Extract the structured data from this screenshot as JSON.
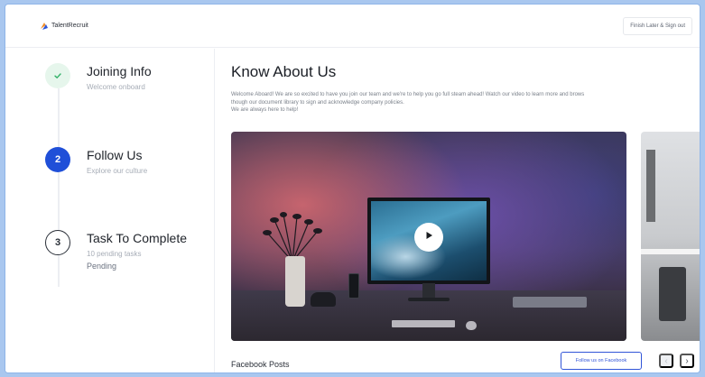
{
  "app": {
    "name": "TalentRecruit"
  },
  "header": {
    "signout_label": "Finish Later & Sign out"
  },
  "steps": [
    {
      "index": "✓",
      "title": "Joining Info",
      "subtitle": "Welcome onboard",
      "state": "done"
    },
    {
      "index": "2",
      "title": "Follow Us",
      "subtitle": "Explore our culture",
      "state": "active"
    },
    {
      "index": "3",
      "title": "Task To Complete",
      "subtitle": "10 pending tasks",
      "status": "Pending",
      "state": "pending"
    }
  ],
  "main": {
    "title": "Know About Us",
    "intro_lines": [
      "Welcome Aboard! We are so excited to have you join our team and we're to help you go full steam ahead! Watch our video to learn more and brows",
      "though our document library to sign and acknowledge company policies.",
      "We are always here to help!"
    ],
    "facebook": {
      "title": "Facebook Posts",
      "follow_label": "Follow us on Facebook",
      "prev": "‹",
      "next": "›"
    }
  },
  "colors": {
    "accent": "#1f4fd8",
    "success": "#35b36a",
    "background": "#a9c7ef"
  },
  "icons": {
    "logo": "talentrecruit-logo-icon",
    "play": "play-icon",
    "check": "check-icon"
  }
}
